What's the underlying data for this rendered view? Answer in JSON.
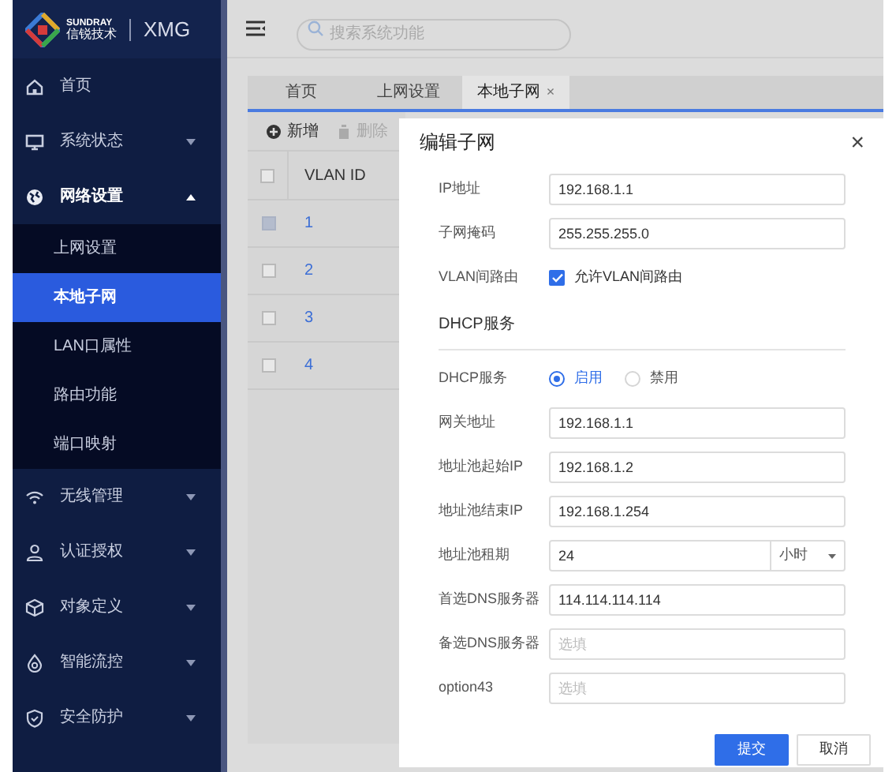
{
  "header": {
    "brand_top": "SUNDRAY",
    "brand_cn": "信锐技术",
    "product": "XMG",
    "search": {
      "placeholder": "搜索系统功能"
    }
  },
  "sidebar": {
    "items": [
      {
        "label": "首页",
        "kind": "link"
      },
      {
        "label": "系统状态",
        "kind": "group",
        "expanded": false
      },
      {
        "label": "网络设置",
        "kind": "group",
        "expanded": true,
        "children": [
          {
            "label": "上网设置",
            "selected": false
          },
          {
            "label": "本地子网",
            "selected": true
          },
          {
            "label": "LAN口属性",
            "selected": false
          },
          {
            "label": "路由功能",
            "selected": false
          },
          {
            "label": "端口映射",
            "selected": false
          }
        ]
      },
      {
        "label": "无线管理",
        "kind": "group",
        "expanded": false
      },
      {
        "label": "认证授权",
        "kind": "group",
        "expanded": false
      },
      {
        "label": "对象定义",
        "kind": "group",
        "expanded": false
      },
      {
        "label": "智能流控",
        "kind": "group",
        "expanded": false
      },
      {
        "label": "安全防护",
        "kind": "group",
        "expanded": false
      }
    ]
  },
  "tabs": [
    {
      "label": "首页",
      "selected": false
    },
    {
      "label": "上网设置",
      "selected": false
    },
    {
      "label": "本地子网",
      "selected": true,
      "close": "×"
    }
  ],
  "toolbar": [
    {
      "label": "新增",
      "kind": "add"
    },
    {
      "label": "删除",
      "kind": "delete"
    }
  ],
  "table": {
    "all_checked": false,
    "columns": [
      "VLAN ID"
    ],
    "rows": [
      {
        "cells": [
          "1"
        ],
        "disabled": true
      },
      {
        "cells": [
          "2"
        ],
        "disabled": false
      },
      {
        "cells": [
          "3"
        ],
        "disabled": false
      },
      {
        "cells": [
          "4"
        ],
        "disabled": false
      }
    ]
  },
  "dialog": {
    "title": "编辑子网",
    "close": "×",
    "fields": [
      {
        "kind": "text",
        "label": "IP地址",
        "value": "192.168.1.1"
      },
      {
        "kind": "text",
        "label": "子网掩码",
        "value": "255.255.255.0"
      },
      {
        "kind": "checkbox",
        "label": "VLAN间路由",
        "option": "允许VLAN间路由",
        "checked": true
      },
      {
        "kind": "section",
        "label": "DHCP服务"
      },
      {
        "kind": "radio",
        "label": "DHCP服务",
        "options": [
          {
            "label": "启用",
            "selected": true
          },
          {
            "label": "禁用",
            "selected": false
          }
        ]
      },
      {
        "kind": "text",
        "label": "网关地址",
        "value": "192.168.1.1"
      },
      {
        "kind": "text",
        "label": "地址池起始IP",
        "value": "192.168.1.2"
      },
      {
        "kind": "text",
        "label": "地址池结束IP",
        "value": "192.168.1.254"
      },
      {
        "kind": "select",
        "label": "地址池租期",
        "value": "24",
        "unit": "小时"
      },
      {
        "kind": "text",
        "label": "首选DNS服务器",
        "value": "114.114.114.114"
      },
      {
        "kind": "text",
        "label": "备选DNS服务器",
        "placeholder": "选填"
      },
      {
        "kind": "text",
        "label": "option43",
        "placeholder": "选填"
      }
    ],
    "buttons": [
      {
        "label": "提交",
        "kind": "primary"
      },
      {
        "label": "取消",
        "kind": "default"
      }
    ]
  }
}
